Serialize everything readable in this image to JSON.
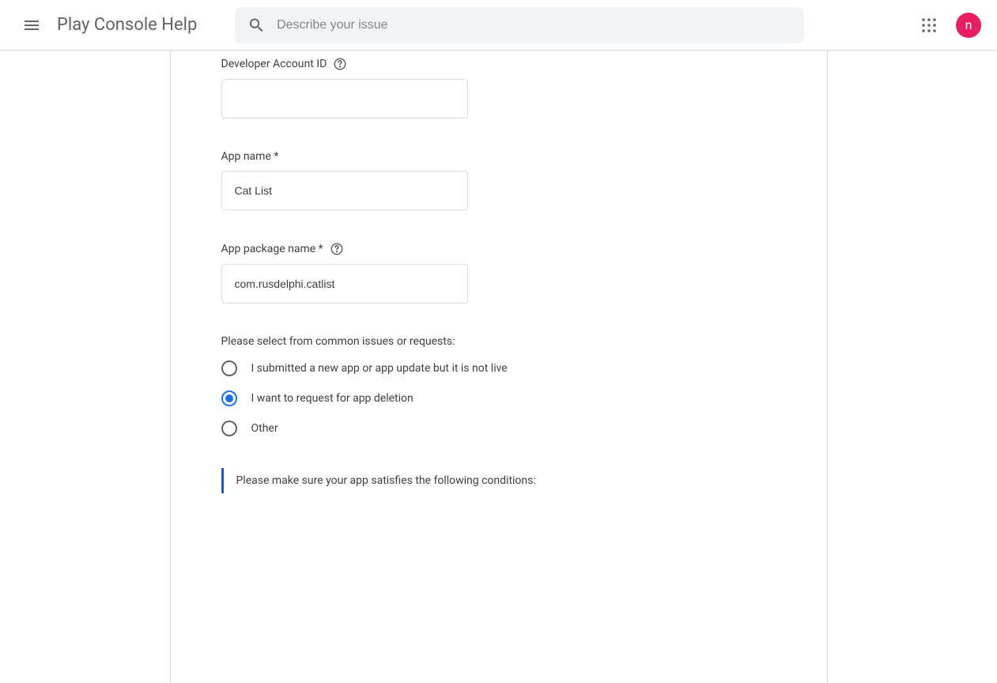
{
  "header": {
    "title": "Play Console Help",
    "search_placeholder": "Describe your issue",
    "avatar_letter": "n"
  },
  "form": {
    "dev_account_id_label": "Developer Account ID",
    "dev_account_id_value": "",
    "app_name_label": "App name *",
    "app_name_value": "Cat List",
    "package_name_label": "App package name *",
    "package_name_value": "com.rusdelphi.catlist",
    "radio_prompt": "Please select from common issues or requests:",
    "radios": [
      {
        "label": "I submitted a new app or app update but it is not live",
        "selected": false
      },
      {
        "label": "I want to request for app deletion",
        "selected": true
      },
      {
        "label": "Other",
        "selected": false
      }
    ],
    "info_text": "Please make sure your app satisfies the following conditions:"
  }
}
